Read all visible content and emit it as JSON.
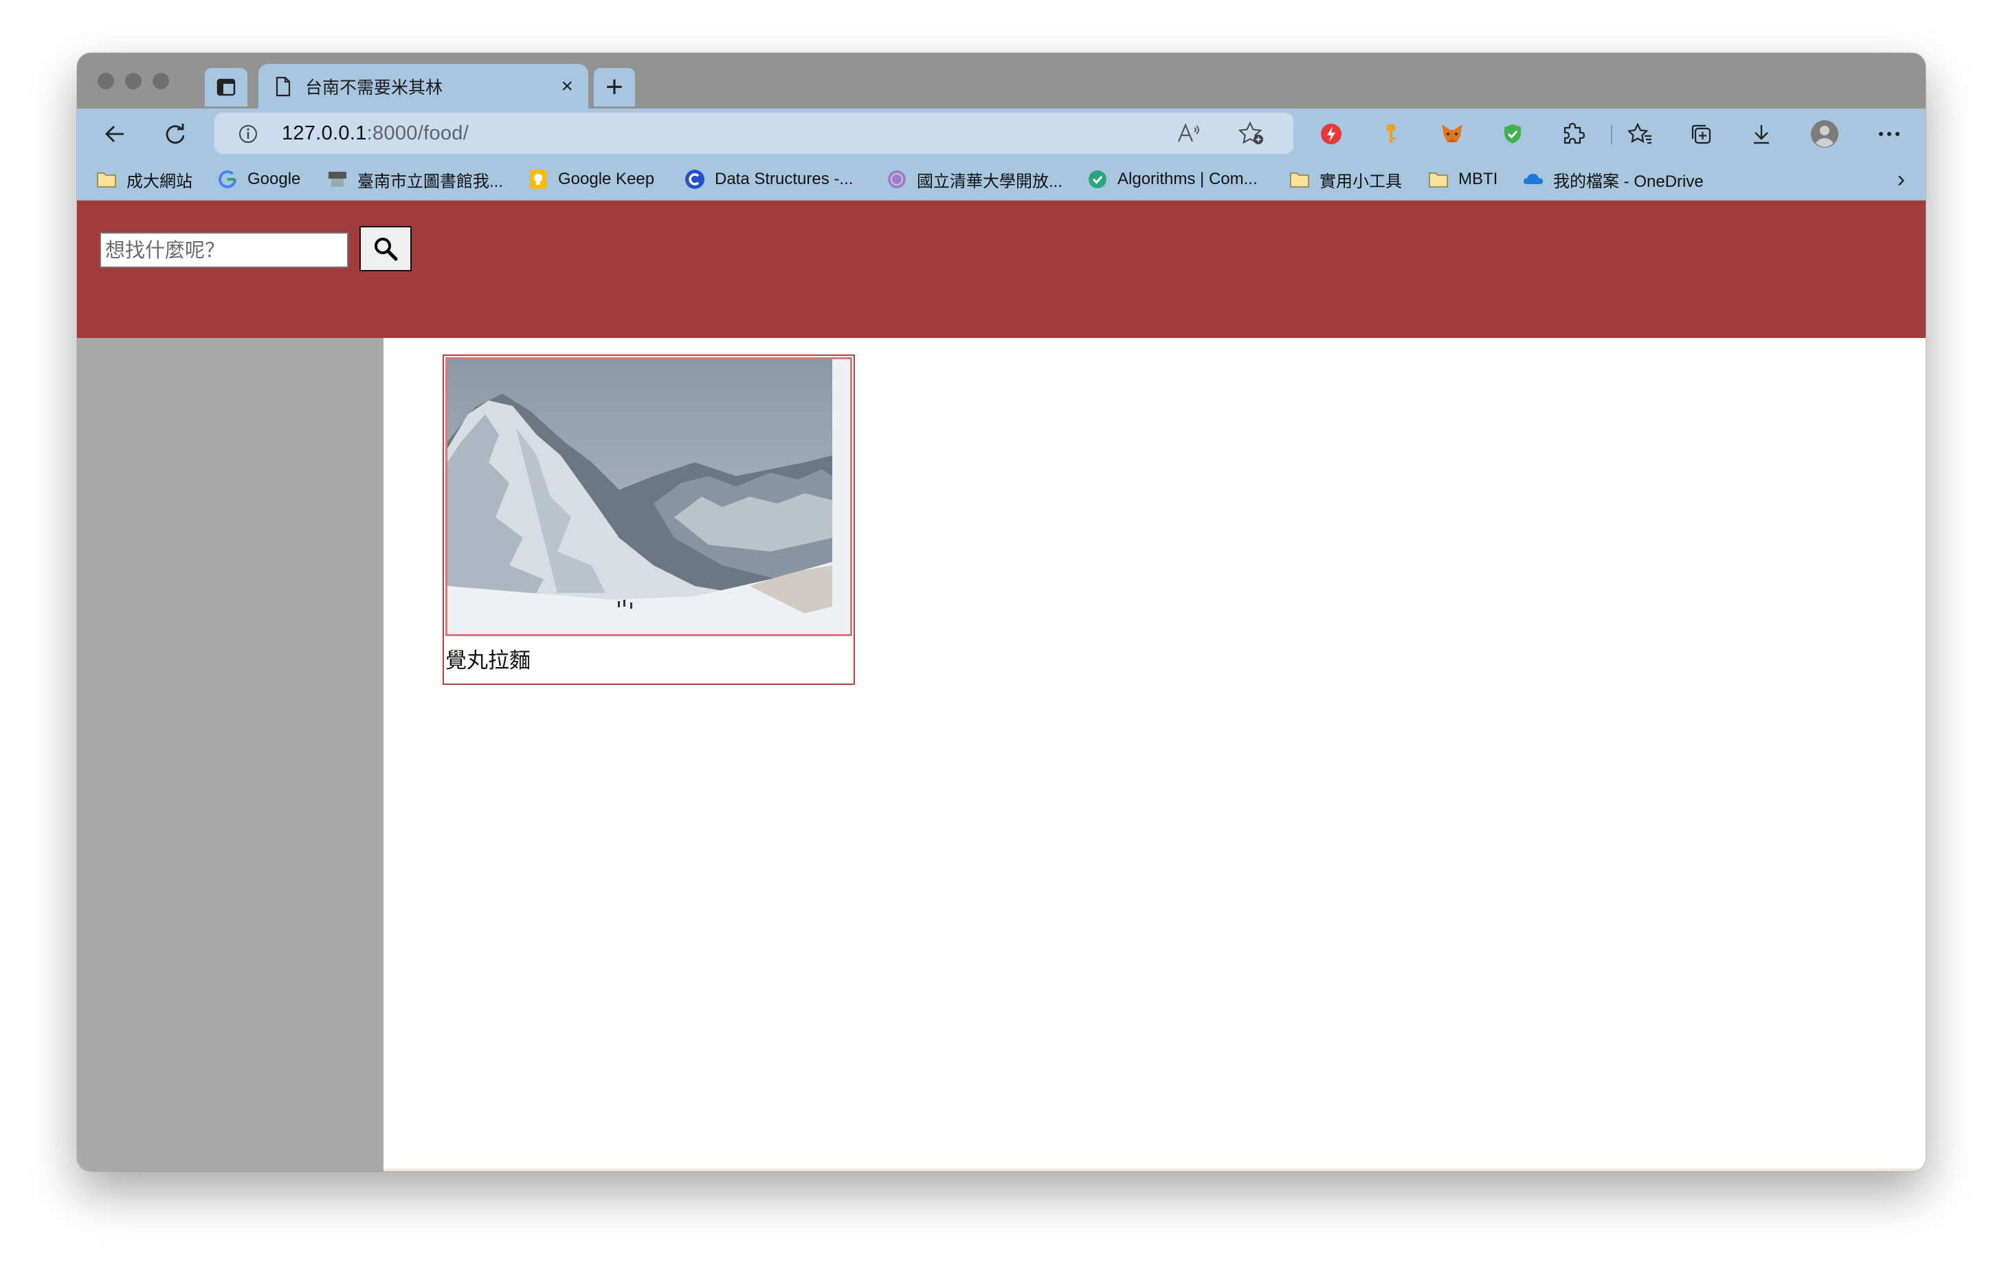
{
  "browser": {
    "tab": {
      "title": "台南不需要米其林"
    },
    "address": {
      "host": "127.0.0.1",
      "rest": ":8000/food/"
    },
    "bookmarks": [
      {
        "label": "成大網站",
        "icon": "folder-icon"
      },
      {
        "label": "Google",
        "icon": "google-icon"
      },
      {
        "label": "臺南市立圖書館我...",
        "icon": "library-icon"
      },
      {
        "label": "Google Keep",
        "icon": "keep-icon"
      },
      {
        "label": "Data Structures -...",
        "icon": "c-logo-icon"
      },
      {
        "label": "國立清華大學開放...",
        "icon": "university-icon"
      },
      {
        "label": "Algorithms | Com...",
        "icon": "checkmark-logo-icon"
      },
      {
        "label": "實用小工具",
        "icon": "folder-icon"
      },
      {
        "label": "MBTI",
        "icon": "folder-icon"
      },
      {
        "label": "我的檔案 - OneDrive",
        "icon": "onedrive-icon"
      }
    ]
  },
  "page": {
    "search": {
      "placeholder": "想找什麼呢？",
      "value": ""
    },
    "cards": [
      {
        "title": "覺丸拉麵",
        "image": "snowy-mountain-photo"
      }
    ]
  },
  "colors": {
    "header": "#a03c3c",
    "sidebar": "#a9a9a9",
    "browser_chrome": "#a9c6e1"
  }
}
